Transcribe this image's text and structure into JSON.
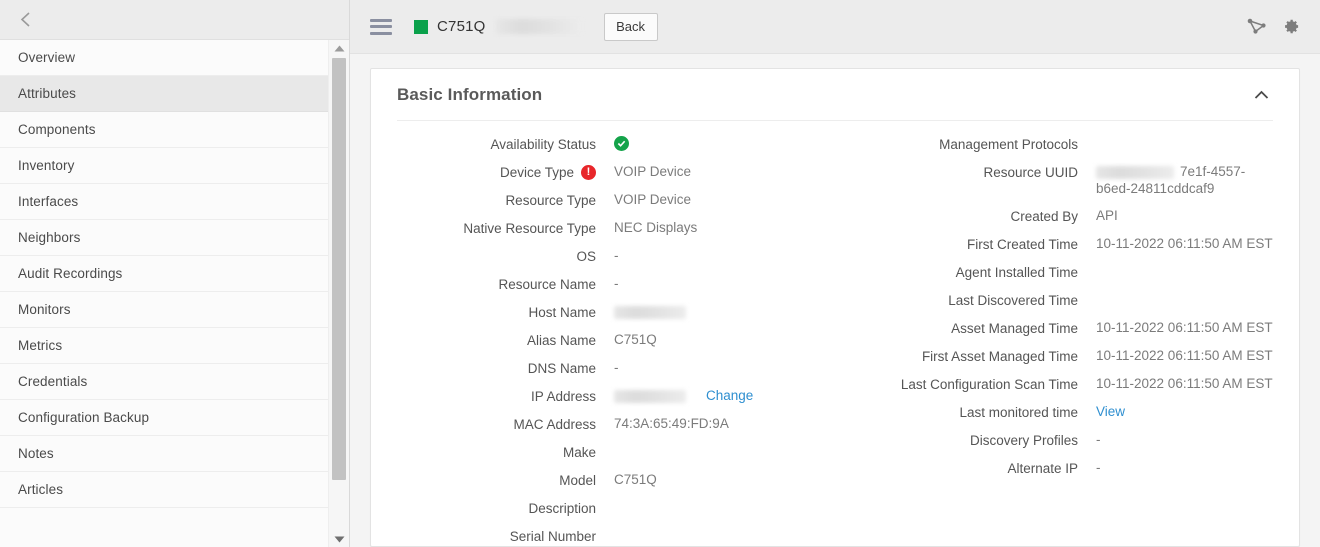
{
  "sidebar": {
    "collapse_icon": "chevron-left-icon",
    "items": [
      {
        "label": "Overview",
        "selected": false
      },
      {
        "label": "Attributes",
        "selected": true
      },
      {
        "label": "Components",
        "selected": false
      },
      {
        "label": "Inventory",
        "selected": false
      },
      {
        "label": "Interfaces",
        "selected": false
      },
      {
        "label": "Neighbors",
        "selected": false
      },
      {
        "label": "Audit Recordings",
        "selected": false
      },
      {
        "label": "Monitors",
        "selected": false
      },
      {
        "label": "Metrics",
        "selected": false
      },
      {
        "label": "Credentials",
        "selected": false
      },
      {
        "label": "Configuration Backup",
        "selected": false
      },
      {
        "label": "Notes",
        "selected": false
      },
      {
        "label": "Articles",
        "selected": false
      }
    ]
  },
  "toolbar": {
    "menu_icon": "hamburger-menu-icon",
    "status_color": "#0aa14b",
    "device_name": "C751Q",
    "back_label": "Back",
    "topology_icon": "topology-icon",
    "settings_icon": "gear-icon"
  },
  "card": {
    "title": "Basic Information",
    "collapse_icon": "chevron-up-icon"
  },
  "fields": {
    "left": [
      {
        "label": "Availability Status",
        "value": "",
        "icon": "check-circle-icon",
        "badge": ""
      },
      {
        "label": "Device Type",
        "value": "VOIP Device",
        "badge": "alert-circle-icon"
      },
      {
        "label": "Resource Type",
        "value": "VOIP Device"
      },
      {
        "label": "Native Resource Type",
        "value": "NEC Displays"
      },
      {
        "label": "OS",
        "value": "-"
      },
      {
        "label": "Resource Name",
        "value": "-"
      },
      {
        "label": "Host Name",
        "value": "",
        "redacted": true
      },
      {
        "label": "Alias Name",
        "value": "C751Q"
      },
      {
        "label": "DNS Name",
        "value": "-"
      },
      {
        "label": "IP Address",
        "value": "",
        "redacted": true,
        "link": "Change"
      },
      {
        "label": "MAC Address",
        "value": "74:3A:65:49:FD:9A"
      },
      {
        "label": "Make",
        "value": ""
      },
      {
        "label": "Model",
        "value": "C751Q"
      },
      {
        "label": "Description",
        "value": ""
      },
      {
        "label": "Serial Number",
        "value": ""
      }
    ],
    "right": [
      {
        "label": "Management Protocols",
        "value": ""
      },
      {
        "label": "Resource UUID",
        "value": "7e1f-4557-b6ed-24811cddcaf9",
        "redacted_prefix": true
      },
      {
        "label": "Created By",
        "value": "API"
      },
      {
        "label": "First Created Time",
        "value": "10-11-2022 06:11:50 AM EST"
      },
      {
        "label": "Agent Installed Time",
        "value": ""
      },
      {
        "label": "Last Discovered Time",
        "value": ""
      },
      {
        "label": "Asset Managed Time",
        "value": "10-11-2022 06:11:50 AM EST"
      },
      {
        "label": "First Asset Managed Time",
        "value": "10-11-2022 06:11:50 AM EST"
      },
      {
        "label": "Last Configuration Scan Time",
        "value": "10-11-2022 06:11:50 AM EST"
      },
      {
        "label": "Last monitored time",
        "value": "",
        "link": "View"
      },
      {
        "label": "Discovery Profiles",
        "value": "-"
      },
      {
        "label": "Alternate IP",
        "value": "-"
      }
    ]
  },
  "colors": {
    "accent_link": "#2f8fd0",
    "status_ok": "#14a34a",
    "status_alert": "#e8262a"
  }
}
